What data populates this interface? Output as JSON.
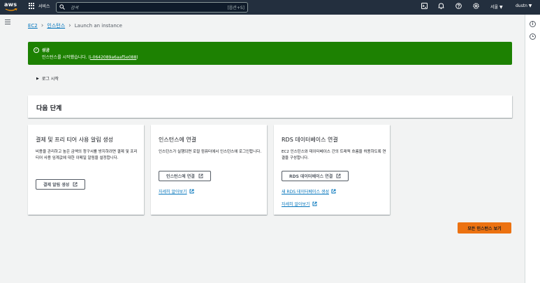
{
  "topnav": {
    "logo_text": "aws",
    "services_label": "서비스",
    "search_placeholder": "검색",
    "search_shortcut": "[옵션+S]",
    "region": "서울 ▼",
    "user": "dustn ▼"
  },
  "breadcrumb": {
    "items": [
      "EC2",
      "인스턴스",
      "Launch an instance"
    ]
  },
  "flash": {
    "title": "성공",
    "message_prefix": "인스턴스를 시작했습니다. (",
    "instance_id": "i-0642089a6aaf5e088",
    "message_suffix": ")"
  },
  "log": {
    "label": "로그 시작"
  },
  "next_steps": {
    "title": "다음 단계"
  },
  "cards": [
    {
      "title": "결제 및 프리 티어 사용 알림 생성",
      "desc": "비용을 관리하고 높은 금액의 청구서를 방지하려면 결제 및 프리 티어 사용 임계값에 대한 이메일 알림을 설정합니다.",
      "button": "결제 알림 생성"
    },
    {
      "title": "인스턴스에 연결",
      "desc": "인스턴스가 실행되면 로컬 컴퓨터에서 인스턴스에 로그인합니다.",
      "button": "인스턴스에 연결",
      "link": "자세히 알아보기"
    },
    {
      "title": "RDS 데이터베이스 연결",
      "desc": "EC2 인스턴스와 데이터베이스 간의 트래픽 흐름을 허용하도록 연결을 구성합니다.",
      "button": "RDS 데이터베이스 연결",
      "link1": "새 RDS 데이터베이스 생성",
      "link2": "자세히 알아보기"
    }
  ],
  "primary_button": "모든 인스턴스 보기",
  "colors": {
    "nav": "#232f3e",
    "success": "#1d8102",
    "primary": "#ec7211",
    "link": "#0073bb"
  }
}
